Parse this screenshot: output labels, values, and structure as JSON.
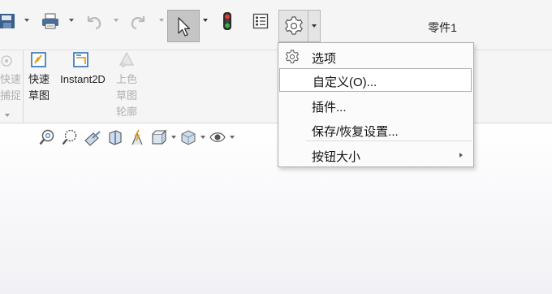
{
  "app": {
    "document_title": "零件1",
    "accent_color": "#2b6cb0"
  },
  "toolbar": {
    "icons": [
      "save-icon",
      "print-icon",
      "undo-icon",
      "redo-icon",
      "select-cursor-icon",
      "rebuild-icon",
      "file-properties-icon",
      "options-gear-icon"
    ]
  },
  "command_manager": {
    "partial_tool": {
      "label_line1": "快速",
      "label_line2": "捕捉"
    },
    "sketch_tools": [
      {
        "label_line1": "快速",
        "label_line2": "草图",
        "icon": "quick-sketch-icon",
        "enabled": true
      },
      {
        "label_line1": "Instant2D",
        "label_line2": "",
        "icon": "instant2d-icon",
        "enabled": true
      },
      {
        "label_line1": "上色",
        "label_line2": "草图",
        "label_line3": "轮廓",
        "icon": "shaded-sketch-contours-icon",
        "enabled": false
      }
    ]
  },
  "heads_up_toolbar": {
    "icons": [
      "zoom-to-fit-icon",
      "zoom-to-area-icon",
      "previous-view-icon",
      "section-view-icon",
      "dynamic-annotation-view-icon",
      "view-orientation-icon",
      "display-style-icon",
      "hide-show-items-icon"
    ]
  },
  "options_menu": {
    "items": [
      {
        "label": "选项",
        "icon": "options-gear-icon",
        "has_submenu": false,
        "highlighted": false
      },
      {
        "label": "自定义(O)...",
        "has_submenu": false,
        "highlighted": true
      },
      {
        "label": "插件...",
        "has_submenu": false,
        "highlighted": false
      },
      {
        "label": "保存/恢复设置...",
        "has_submenu": false,
        "highlighted": false
      },
      {
        "label": "按钮大小",
        "has_submenu": true,
        "highlighted": false
      }
    ]
  }
}
